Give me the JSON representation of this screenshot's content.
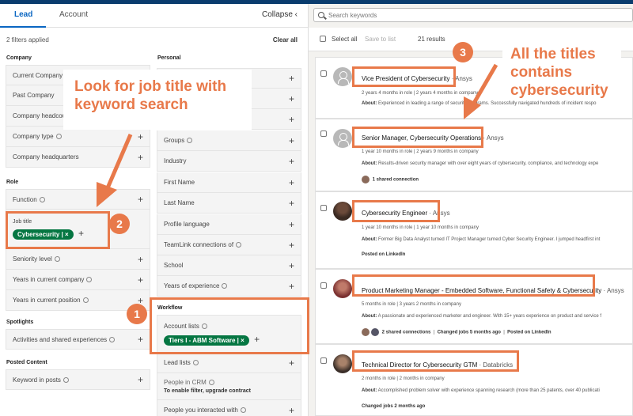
{
  "left": {
    "tabs": [
      "Lead",
      "Account"
    ],
    "collapse": "Collapse ‹",
    "filters_applied": "2 filters applied",
    "clear_all": "Clear all",
    "company_title": "Company",
    "company_rows": [
      "Current Company",
      "Past Company",
      "Company headcou…",
      "Company type",
      "Company headquarters"
    ],
    "role_title": "Role",
    "function": "Function",
    "job_title": "Job title",
    "job_pill": "Cybersecurity | ×",
    "role_rows": [
      "Seniority level",
      "Years in current company",
      "Years in current position"
    ],
    "spotlights_title": "Spotlights",
    "spotlights_row": "Activities and shared experiences",
    "posted_title": "Posted Content",
    "posted_row": "Keyword in posts",
    "personal_title": "Personal",
    "personal_rows": [
      "Groups",
      "Industry",
      "First Name",
      "Last Name",
      "Profile language",
      "TeamLink connections of",
      "School",
      "Years of experience"
    ],
    "workflow_title": "Workflow",
    "account_lists": "Account lists",
    "account_pill": "Tiers I - ABM Software | ×",
    "lead_lists": "Lead lists",
    "crm": "People in CRM",
    "crm_sub": "To enable filter, upgrade contract",
    "interacted": "People you interacted with"
  },
  "right": {
    "search_placeholder": "Search keywords",
    "select_all": "Select all",
    "save_to_list": "Save to list",
    "results": "21 results",
    "cards": [
      {
        "title": "Vice President of Cybersecurity",
        "company": "· Ansys",
        "tenure": "2 years 4 months in role | 2 years 4 months in company",
        "about_label": "About:",
        "about": "Experienced in leading a range of security programs. Successfully navigated hundreds of incident respo"
      },
      {
        "title": "Senior Manager, Cybersecurity Operations",
        "company": "· Ansys",
        "tenure": "1 year 10 months in role | 2 years 9 months in company",
        "about_label": "About:",
        "about": "Results-driven security manager with over eight years of cybersecurity, compliance, and technology expe",
        "extra": "1 shared connection"
      },
      {
        "title": "Cybersecurity Engineer",
        "company": "· Ansys",
        "tenure": "1 year 10 months in role | 1 year 10 months in company",
        "about_label": "About:",
        "about": "Former Big Data Analyst turned IT Project Manager turned Cyber Security Engineer. I jumped headfirst int",
        "extra": "Posted on LinkedIn"
      },
      {
        "title": "Product Marketing Manager - Embedded Software, Functional Safety & Cybersecurity",
        "company": "· Ansys",
        "tenure": "5 months in role | 3 years 2 months in company",
        "about_label": "About:",
        "about": "A passionate and experienced marketer and engineer. With 15+ years experience on product and service f",
        "extra": "2 shared connections",
        "extra2": "Changed jobs 5 months ago",
        "extra3": "Posted on LinkedIn"
      },
      {
        "title": "Technical Director for Cybersecurity GTM",
        "company": "· Databricks",
        "tenure": "2 months in role | 2 months in company",
        "about_label": "About:",
        "about": "Accomplished problem solver with experience spanning research (more than 25 patents, over 40 publicati",
        "extra": "Changed jobs 2 months ago"
      }
    ]
  },
  "annotations": {
    "badge1": "1",
    "badge2": "2",
    "badge3": "3",
    "callout_left": "Look for job title with keyword search",
    "callout_right": "All the titles contains cybersecurity"
  },
  "colors": {
    "accent": "#e8794a",
    "pill_green": "#057642",
    "link_blue": "#0a66c2"
  }
}
